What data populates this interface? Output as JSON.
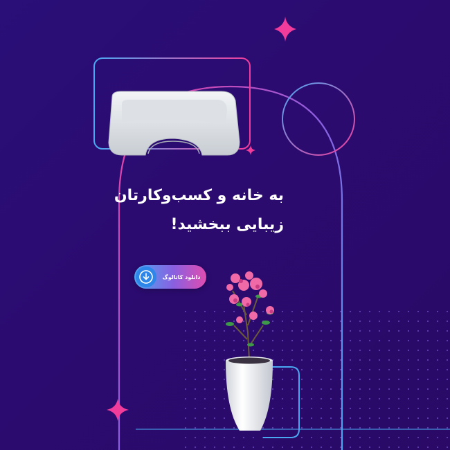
{
  "headline": {
    "line1": "به خانه و کسب‌وکارتان",
    "line2": "زیبایی ببخشید!"
  },
  "cta": {
    "label": "دانلود کاتالوگ",
    "icon": "download-icon"
  },
  "images": {
    "sofa": "outdoor-sofa-image",
    "planter": "planter-with-flowering-plant-image"
  },
  "colors": {
    "background": "#2a0f78",
    "accent_pink": "#f23c9c",
    "accent_blue": "#4aa8f2",
    "accent_purple": "#8a5fe0"
  }
}
